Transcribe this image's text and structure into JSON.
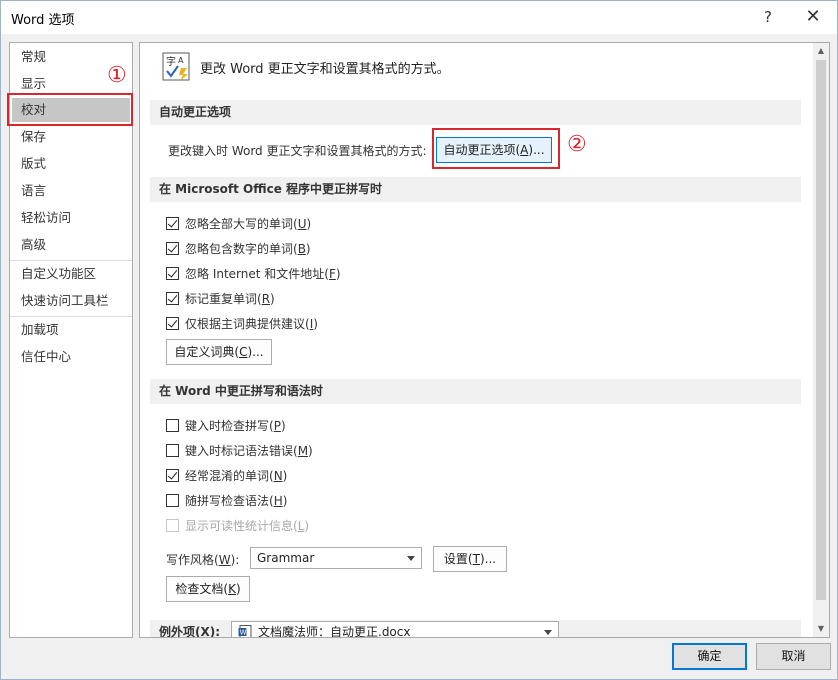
{
  "window": {
    "title": "Word 选项",
    "help_glyph": "?",
    "close_glyph": "✕"
  },
  "nav": {
    "items": [
      {
        "label": "常规"
      },
      {
        "label": "显示"
      },
      {
        "label": "校对"
      },
      {
        "label": "保存"
      },
      {
        "label": "版式"
      },
      {
        "label": "语言"
      },
      {
        "label": "轻松访问"
      },
      {
        "label": "高级"
      },
      {
        "label": "自定义功能区"
      },
      {
        "label": "快速访问工具栏"
      },
      {
        "label": "加载项"
      },
      {
        "label": "信任中心"
      }
    ],
    "selected_label": "校对"
  },
  "annotations": {
    "marker1": "①",
    "marker2": "②",
    "color": "#d9272e"
  },
  "header": {
    "icon": "proofing-abc-check-icon",
    "text": "更改 Word 更正文字和设置其格式的方式。"
  },
  "autocorrect": {
    "section_title": "自动更正选项",
    "description": "更改键入时 Word 更正文字和设置其格式的方式:",
    "button_prefix": "自动更正选项(",
    "button_key": "A",
    "button_suffix": ")..."
  },
  "office_spelling": {
    "section_title": "在 Microsoft Office 程序中更正拼写时",
    "checkboxes": [
      {
        "label": "忽略全部大写的单词(",
        "key": "U",
        "end": ")",
        "checked": true
      },
      {
        "label": "忽略包含数字的单词(",
        "key": "B",
        "end": ")",
        "checked": true
      },
      {
        "label": "忽略 Internet 和文件地址(",
        "key": "F",
        "end": ")",
        "checked": true
      },
      {
        "label": "标记重复单词(",
        "key": "R",
        "end": ")",
        "checked": true
      },
      {
        "label": "仅根据主词典提供建议(",
        "key": "I",
        "end": ")",
        "checked": true
      }
    ],
    "custom_dict_prefix": "自定义词典(",
    "custom_dict_key": "C",
    "custom_dict_suffix": ")..."
  },
  "word_grammar": {
    "section_title": "在 Word 中更正拼写和语法时",
    "checkboxes": [
      {
        "label": "键入时检查拼写(",
        "key": "P",
        "end": ")",
        "checked": false,
        "disabled": false
      },
      {
        "label": "键入时标记语法错误(",
        "key": "M",
        "end": ")",
        "checked": false,
        "disabled": false
      },
      {
        "label": "经常混淆的单词(",
        "key": "N",
        "end": ")",
        "checked": true,
        "disabled": false
      },
      {
        "label": "随拼写检查语法(",
        "key": "H",
        "end": ")",
        "checked": false,
        "disabled": false
      },
      {
        "label": "显示可读性统计信息(",
        "key": "L",
        "end": ")",
        "checked": false,
        "disabled": true
      }
    ],
    "writing_style_prefix": "写作风格(",
    "writing_style_key": "W",
    "writing_style_suffix": "):",
    "writing_style_value": "Grammar",
    "settings_prefix": "设置(",
    "settings_key": "T",
    "settings_suffix": ")...",
    "recheck_prefix": "检查文档(",
    "recheck_key": "K",
    "recheck_suffix": ")"
  },
  "exceptions": {
    "label_prefix": "例外项(",
    "label_key": "X",
    "label_suffix": "):",
    "doc_icon": "word-document-icon",
    "value": "文档魔法师：自动更正.docx"
  },
  "footer": {
    "ok_label": "确定",
    "cancel_label": "取消"
  }
}
